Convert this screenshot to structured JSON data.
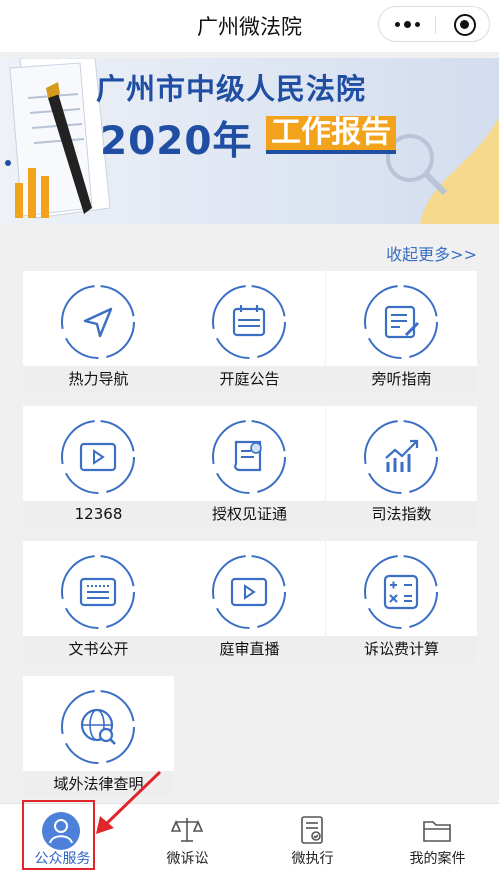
{
  "header": {
    "title": "广州微法院"
  },
  "banner": {
    "line1": "广州市中级人民法院",
    "line2_year": "2020年",
    "line2_tag": "工作报告"
  },
  "more_link": "收起更多>>",
  "services": [
    {
      "label": "热力导航",
      "icon": "navigation-arrow-icon"
    },
    {
      "label": "开庭公告",
      "icon": "calendar-icon"
    },
    {
      "label": "旁听指南",
      "icon": "document-pen-icon"
    },
    {
      "label": "12368",
      "icon": "video-play-icon"
    },
    {
      "label": "授权见证通",
      "icon": "certificate-scroll-icon"
    },
    {
      "label": "司法指数",
      "icon": "trend-chart-icon"
    },
    {
      "label": "文书公开",
      "icon": "document-text-icon"
    },
    {
      "label": "庭审直播",
      "icon": "video-play-icon"
    },
    {
      "label": "诉讼费计算",
      "icon": "calculator-icon"
    },
    {
      "label": "域外法律查明",
      "icon": "globe-search-icon"
    }
  ],
  "tabbar": [
    {
      "label": "公众服务",
      "icon": "person-avatar-icon",
      "active": true
    },
    {
      "label": "微诉讼",
      "icon": "scales-icon"
    },
    {
      "label": "微执行",
      "icon": "checklist-icon"
    },
    {
      "label": "我的案件",
      "icon": "folder-icon"
    }
  ],
  "colors": {
    "accent": "#3b6fc4",
    "brand_dark": "#1f4ea3",
    "banner_orange": "#f3a21b",
    "highlight_red": "#e0262b"
  }
}
